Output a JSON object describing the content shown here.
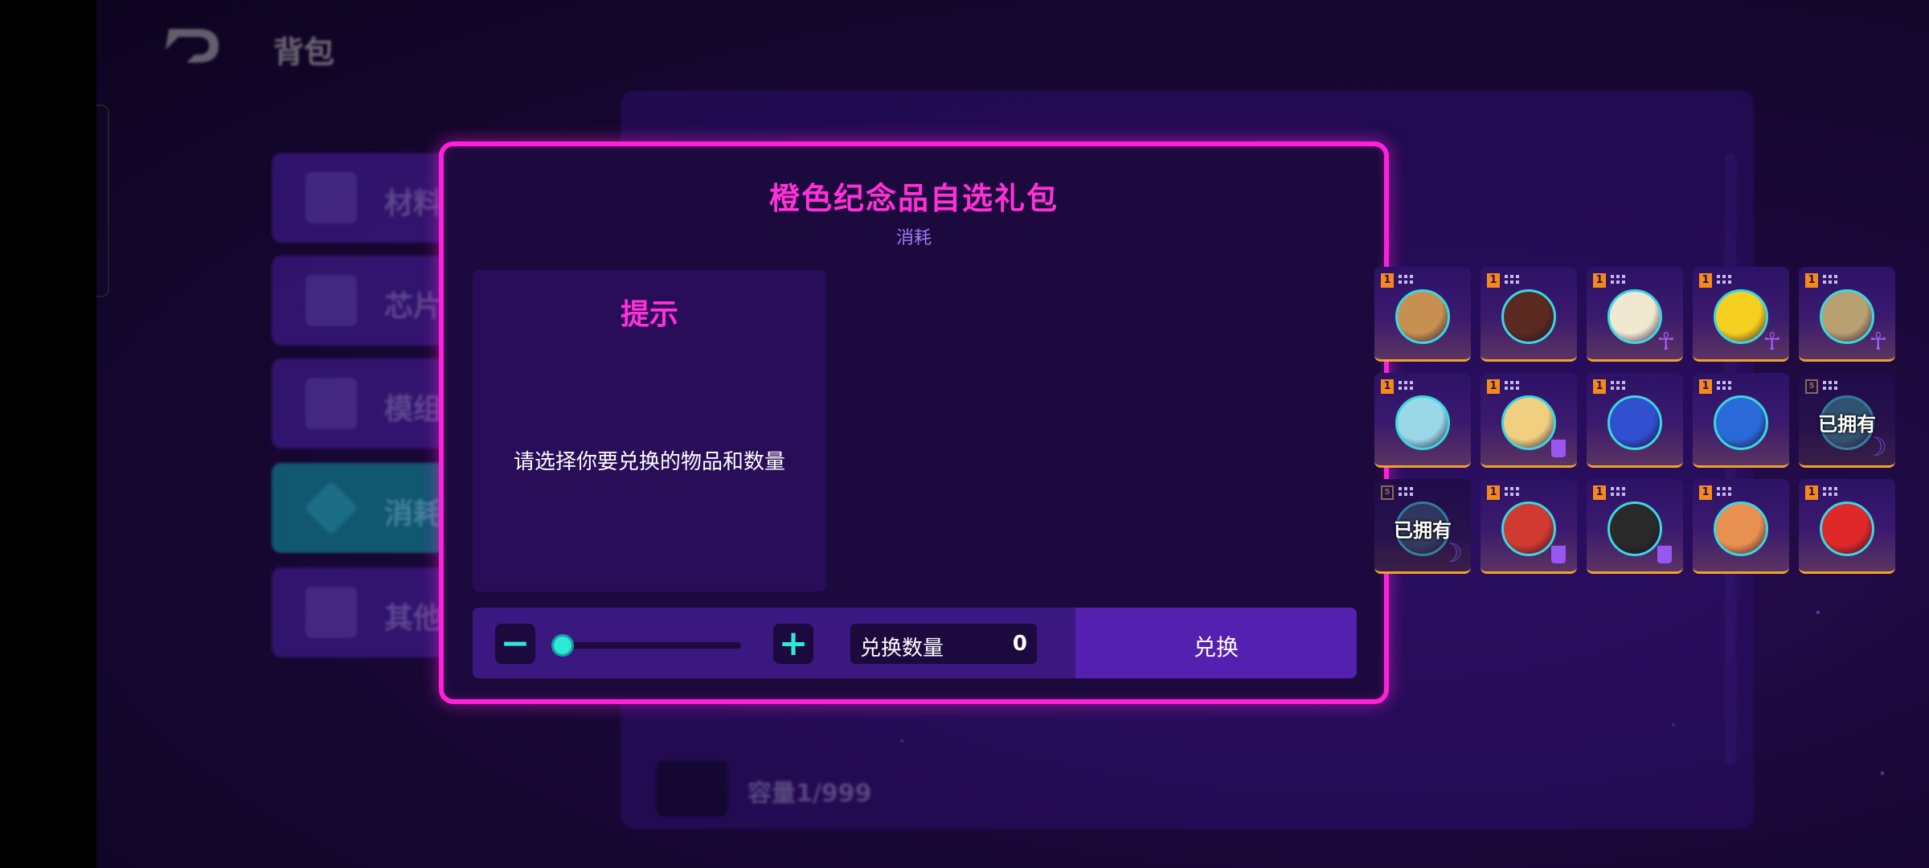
{
  "background": {
    "title": "背包",
    "categories": [
      {
        "label": "材料",
        "active": false
      },
      {
        "label": "芯片",
        "active": false
      },
      {
        "label": "模组",
        "active": false
      },
      {
        "label": "消耗",
        "active": true
      },
      {
        "label": "其他",
        "active": false
      }
    ],
    "capacity_text": "容量1/999"
  },
  "modal": {
    "title": "橙色纪念品自选礼包",
    "subtitle": "消耗",
    "hint_title": "提示",
    "hint_text": "请选择你要兑换的物品和数量",
    "items": [
      {
        "badge": "1",
        "icon": "bronze-helmet-icon",
        "color": "#c89050",
        "owned": false,
        "extra": ""
      },
      {
        "badge": "1",
        "icon": "skull-mask-icon",
        "color": "#5a2a20",
        "owned": false,
        "extra": ""
      },
      {
        "badge": "1",
        "icon": "horn-icon",
        "color": "#f0e8d0",
        "owned": false,
        "extra": "ankh"
      },
      {
        "badge": "1",
        "icon": "jersey-24-icon",
        "color": "#f5d020",
        "owned": false,
        "extra": "ankh"
      },
      {
        "badge": "1",
        "icon": "food-bowl-icon",
        "color": "#b8a070",
        "owned": false,
        "extra": "ankh"
      },
      {
        "badge": "1",
        "icon": "blaster-gun-icon",
        "color": "#9ad8e8",
        "owned": false,
        "extra": ""
      },
      {
        "badge": "1",
        "icon": "popcorn-icon",
        "color": "#f0d080",
        "owned": false,
        "extra": "cup"
      },
      {
        "badge": "1",
        "icon": "blue-slime-icon",
        "color": "#3050d0",
        "owned": false,
        "extra": ""
      },
      {
        "badge": "1",
        "icon": "lungs-scan-icon",
        "color": "#2a6ad8",
        "owned": false,
        "extra": ""
      },
      {
        "badge": "5",
        "icon": "mystery-box-icon",
        "color": "#3a8a90",
        "owned": true,
        "extra": "moon"
      },
      {
        "badge": "5",
        "icon": "phone-icon",
        "color": "#3a5870",
        "owned": true,
        "extra": "moon"
      },
      {
        "badge": "1",
        "icon": "red-book-icon",
        "color": "#d03a30",
        "owned": false,
        "extra": "cup"
      },
      {
        "badge": "1",
        "icon": "bottle-icon",
        "color": "#2a2a2a",
        "owned": false,
        "extra": "cup"
      },
      {
        "badge": "1",
        "icon": "orange-figure-icon",
        "color": "#e89050",
        "owned": false,
        "extra": ""
      },
      {
        "badge": "1",
        "icon": "red-bear-icon",
        "color": "#e02828",
        "owned": false,
        "extra": ""
      }
    ],
    "owned_label": "已拥有",
    "qty_label": "兑换数量",
    "qty_value": "0",
    "minus_label": "−",
    "plus_label": "+",
    "exchange_label": "兑换",
    "slider_fraction": 0
  },
  "colors": {
    "accent_pink": "#ff20d8",
    "accent_cyan": "#2ee8d8",
    "rarity_orange": "#f0a030"
  }
}
